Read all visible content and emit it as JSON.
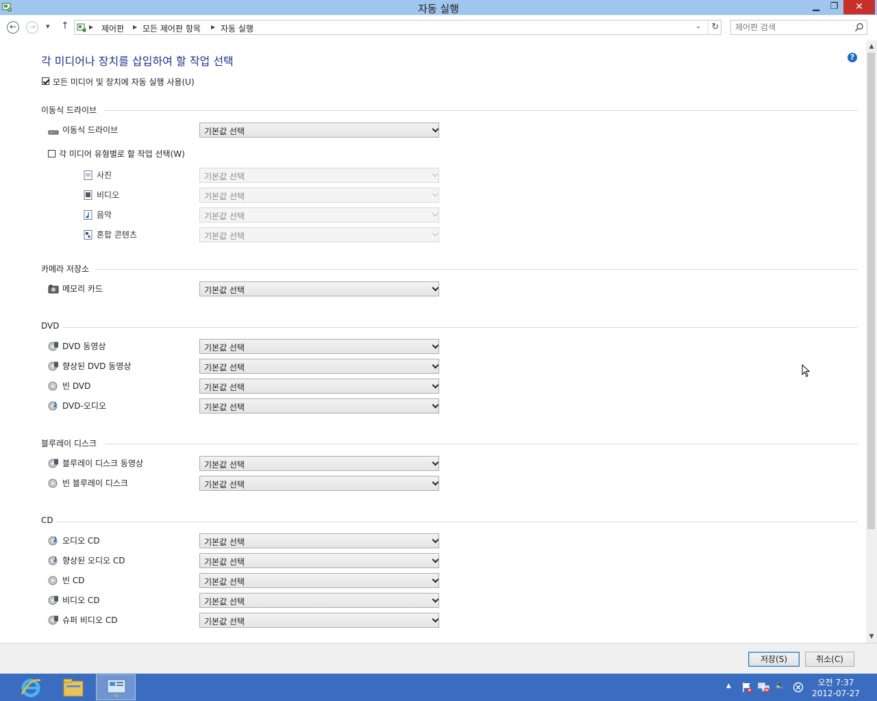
{
  "window": {
    "title": "자동 실행",
    "min_glyph": "▁",
    "max_glyph": "❐",
    "close_glyph": "✕"
  },
  "nav": {
    "back_glyph": "←",
    "forward_glyph": "→",
    "recent_glyph": "▾",
    "up_glyph": "↑",
    "breadcrumbs": [
      "제어판",
      "모든 제어판 항목",
      "자동 실행"
    ],
    "search_placeholder": "제어판 검색",
    "refresh_glyph": "↻",
    "dropdown_glyph": "⌄"
  },
  "page": {
    "heading": "각 미디어나 장치를 삽입하여 할 작업 선택",
    "help_glyph": "?",
    "use_autoplay": {
      "label": "모든 미디어 및 장치에 자동 실행 사용(U)",
      "checked": true
    },
    "removable": {
      "title": "이동식 드라이브",
      "drive": {
        "label": "이동식 드라이브",
        "icon": "removable-drive-icon",
        "value": "기본값 선택"
      },
      "per_type": {
        "label": "각 미디어 유형별로 할 작업 선택(W)",
        "checked": false
      },
      "types": [
        {
          "label": "사진",
          "icon": "photo-icon",
          "value": "기본값 선택"
        },
        {
          "label": "비디오",
          "icon": "video-icon",
          "value": "기본값 선택"
        },
        {
          "label": "음악",
          "icon": "music-icon",
          "value": "기본값 선택"
        },
        {
          "label": "혼합 콘텐츠",
          "icon": "mixed-content-icon",
          "value": "기본값 선택"
        }
      ]
    },
    "camera": {
      "title": "카메라 저장소",
      "items": [
        {
          "label": "메모리 카드",
          "icon": "memory-card-icon",
          "value": "기본값 선택"
        }
      ]
    },
    "dvd": {
      "title": "DVD",
      "items": [
        {
          "label": "DVD 동영상",
          "icon": "dvd-movie-icon",
          "value": "기본값 선택"
        },
        {
          "label": "향상된 DVD 동영상",
          "icon": "enhanced-dvd-movie-icon",
          "value": "기본값 선택"
        },
        {
          "label": "빈 DVD",
          "icon": "blank-disc-icon",
          "value": "기본값 선택"
        },
        {
          "label": "DVD-오디오",
          "icon": "audio-disc-icon",
          "value": "기본값 선택"
        }
      ]
    },
    "bluray": {
      "title": "블루레이 디스크",
      "items": [
        {
          "label": "블루레이 디스크 동영상",
          "icon": "bluray-movie-icon",
          "value": "기본값 선택"
        },
        {
          "label": "빈 블루레이 디스크",
          "icon": "blank-disc-icon",
          "value": "기본값 선택"
        }
      ]
    },
    "cd": {
      "title": "CD",
      "items": [
        {
          "label": "오디오 CD",
          "icon": "audio-cd-icon",
          "value": "기본값 선택"
        },
        {
          "label": "향상된 오디오 CD",
          "icon": "enhanced-audio-cd-icon",
          "value": "기본값 선택"
        },
        {
          "label": "빈 CD",
          "icon": "blank-disc-icon",
          "value": "기본값 선택"
        },
        {
          "label": "비디오 CD",
          "icon": "video-cd-icon",
          "value": "기본값 선택"
        },
        {
          "label": "슈퍼 비디오 CD",
          "icon": "super-video-cd-icon",
          "value": "기본값 선택"
        }
      ]
    }
  },
  "footer": {
    "save_label": "저장(S)",
    "cancel_label": "취소(C)"
  },
  "taskbar": {
    "tray_up_glyph": "▲",
    "volume_glyph": "🔈",
    "time": "오전 7:37",
    "date": "2012-07-27"
  },
  "colors": {
    "accent": "#1e3287",
    "titlebar": "#a0c6ee",
    "taskbar": "#3a6dbf",
    "close": "#c7302b"
  }
}
